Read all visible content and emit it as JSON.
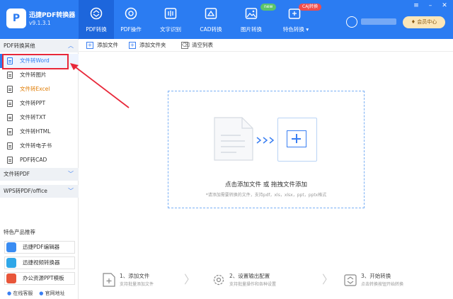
{
  "app": {
    "name": "迅捷PDF转换器",
    "version": "v9.1.3.1"
  },
  "nav": [
    {
      "label": "PDF转换",
      "icon": "convert-icon",
      "active": true
    },
    {
      "label": "PDF操作",
      "icon": "pdf-operation-icon",
      "active": false
    },
    {
      "label": "文字识别",
      "icon": "text-recognition-icon",
      "active": false
    },
    {
      "label": "CAD转换",
      "icon": "cad-icon",
      "active": false
    },
    {
      "label": "图片转换",
      "icon": "image-icon",
      "active": false,
      "badge": "new"
    },
    {
      "label": "特色转换",
      "icon": "special-convert-icon",
      "active": false,
      "badge": "CAJ转换"
    }
  ],
  "header": {
    "vip_label": "会员中心"
  },
  "sidebar": {
    "section_pdf": "PDF转换其他",
    "items": [
      {
        "label": "文件转Word"
      },
      {
        "label": "文件转图片"
      },
      {
        "label": "文件转Excel"
      },
      {
        "label": "文件转PPT"
      },
      {
        "label": "文件转TXT"
      },
      {
        "label": "文件转HTML"
      },
      {
        "label": "文件转电子书"
      },
      {
        "label": "PDF转CAD"
      }
    ],
    "section_to_pdf": "文件转PDF",
    "section_wps": "WPS转PDF/office",
    "recommend_title": "特色产品推荐",
    "recommend": [
      {
        "label": "迅捷PDF编辑器"
      },
      {
        "label": "迅捷视频转换器"
      },
      {
        "label": "办公资源PPT模板"
      }
    ],
    "footer_service": "在线客服",
    "footer_site": "官网地址"
  },
  "toolbar": {
    "add_file": "添加文件",
    "add_folder": "添加文件夹",
    "clear_list": "清空列表"
  },
  "dropzone": {
    "title": "点击添加文件 或 拖拽文件添加",
    "hint": "*请添加需要转换的文件，支持pdf，xls，xlsx，ppt，pptx格式"
  },
  "steps": [
    {
      "title": "1、添加文件",
      "desc": "支持批量添加文件"
    },
    {
      "title": "2、设置输出配置",
      "desc": "支持批量操作和各种设置"
    },
    {
      "title": "3、开始转换",
      "desc": "点击转换按钮开始转换"
    }
  ],
  "colors": {
    "brand": "#2b7cf2",
    "highlight": "#e8283a",
    "excel": "#e07b00"
  }
}
